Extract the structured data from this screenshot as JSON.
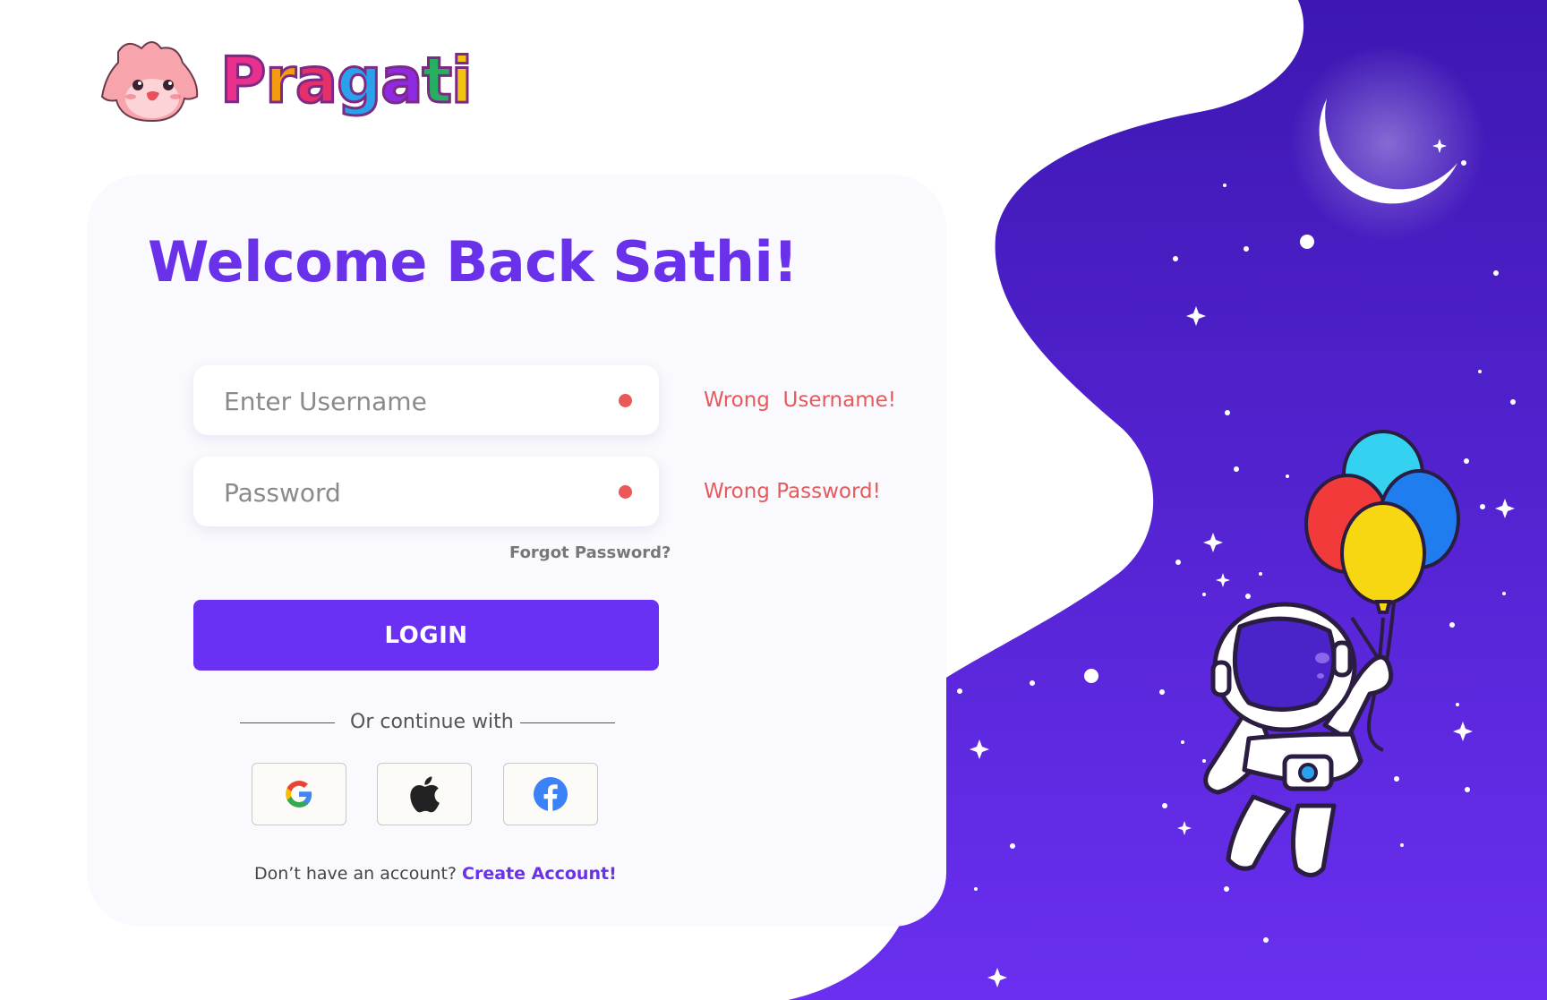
{
  "brand": {
    "name": "Pragati",
    "letter_colors": [
      "#e8308c",
      "#f39c12",
      "#e52e6a",
      "#2aa1ea",
      "#8e2be2",
      "#27ae60",
      "#f1c40f"
    ]
  },
  "login": {
    "title": "Welcome Back Sathi!",
    "username_placeholder": "Enter Username",
    "password_placeholder": "Password",
    "username_error": "Wrong  Username!",
    "password_error": "Wrong Password!",
    "forgot_password": "Forgot Password?",
    "login_button": "LOGIN",
    "divider_text": "Or continue with",
    "signup_prompt": "Don’t have an account?",
    "signup_link": "Create Account!"
  },
  "social": {
    "providers": [
      "google-icon",
      "apple-icon",
      "facebook-icon"
    ]
  },
  "colors": {
    "accent": "#6a31f4",
    "title": "#6a31ea",
    "error": "#e55a5a",
    "error_dot": "#ec5858",
    "panel_gradient_top": "#3d17b2",
    "panel_gradient_bottom": "#6a2ff0"
  }
}
